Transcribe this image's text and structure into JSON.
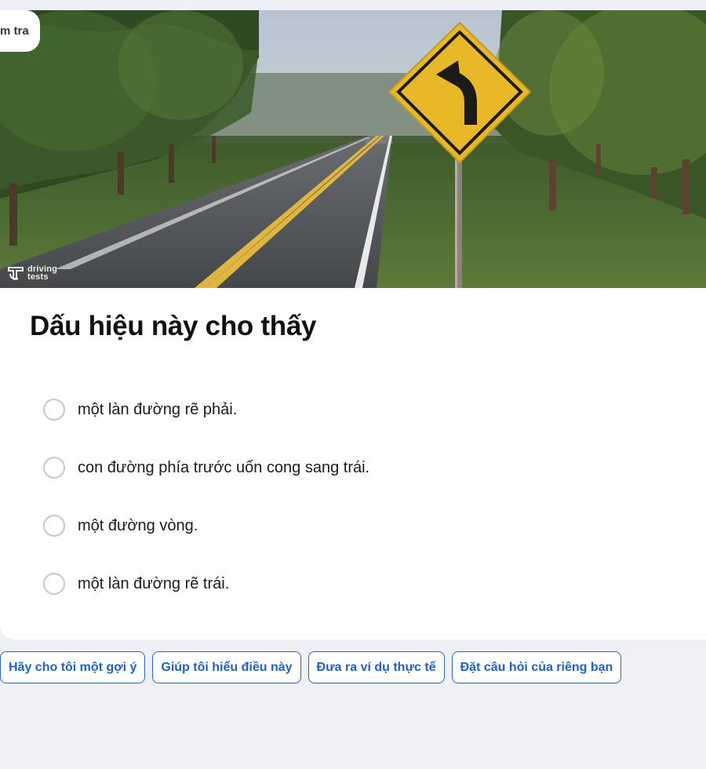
{
  "top_tag": {
    "label": "m tra"
  },
  "hero": {
    "watermark_line1": "driving",
    "watermark_line2": "tests",
    "sign_icon": "curve-left-sign-icon"
  },
  "question": {
    "title": "Dấu hiệu này cho thấy"
  },
  "options": [
    {
      "label": "một làn đường rẽ phải.",
      "selected": false
    },
    {
      "label": "con đường phía trước uốn cong sang trái.",
      "selected": false
    },
    {
      "label": "một đường vòng.",
      "selected": false
    },
    {
      "label": "một làn đường rẽ trái.",
      "selected": false
    }
  ],
  "suggestions": [
    {
      "label": "Hãy cho tôi một gợi ý"
    },
    {
      "label": "Giúp tôi hiểu điều này"
    },
    {
      "label": "Đưa ra ví dụ thực tế"
    },
    {
      "label": "Đặt câu hỏi của riêng bạn"
    }
  ],
  "colors": {
    "accent": "#1d62c8",
    "page_background": "#eff0f5",
    "radio_border": "#c4c6d0",
    "sign_yellow": "#e8b829"
  }
}
